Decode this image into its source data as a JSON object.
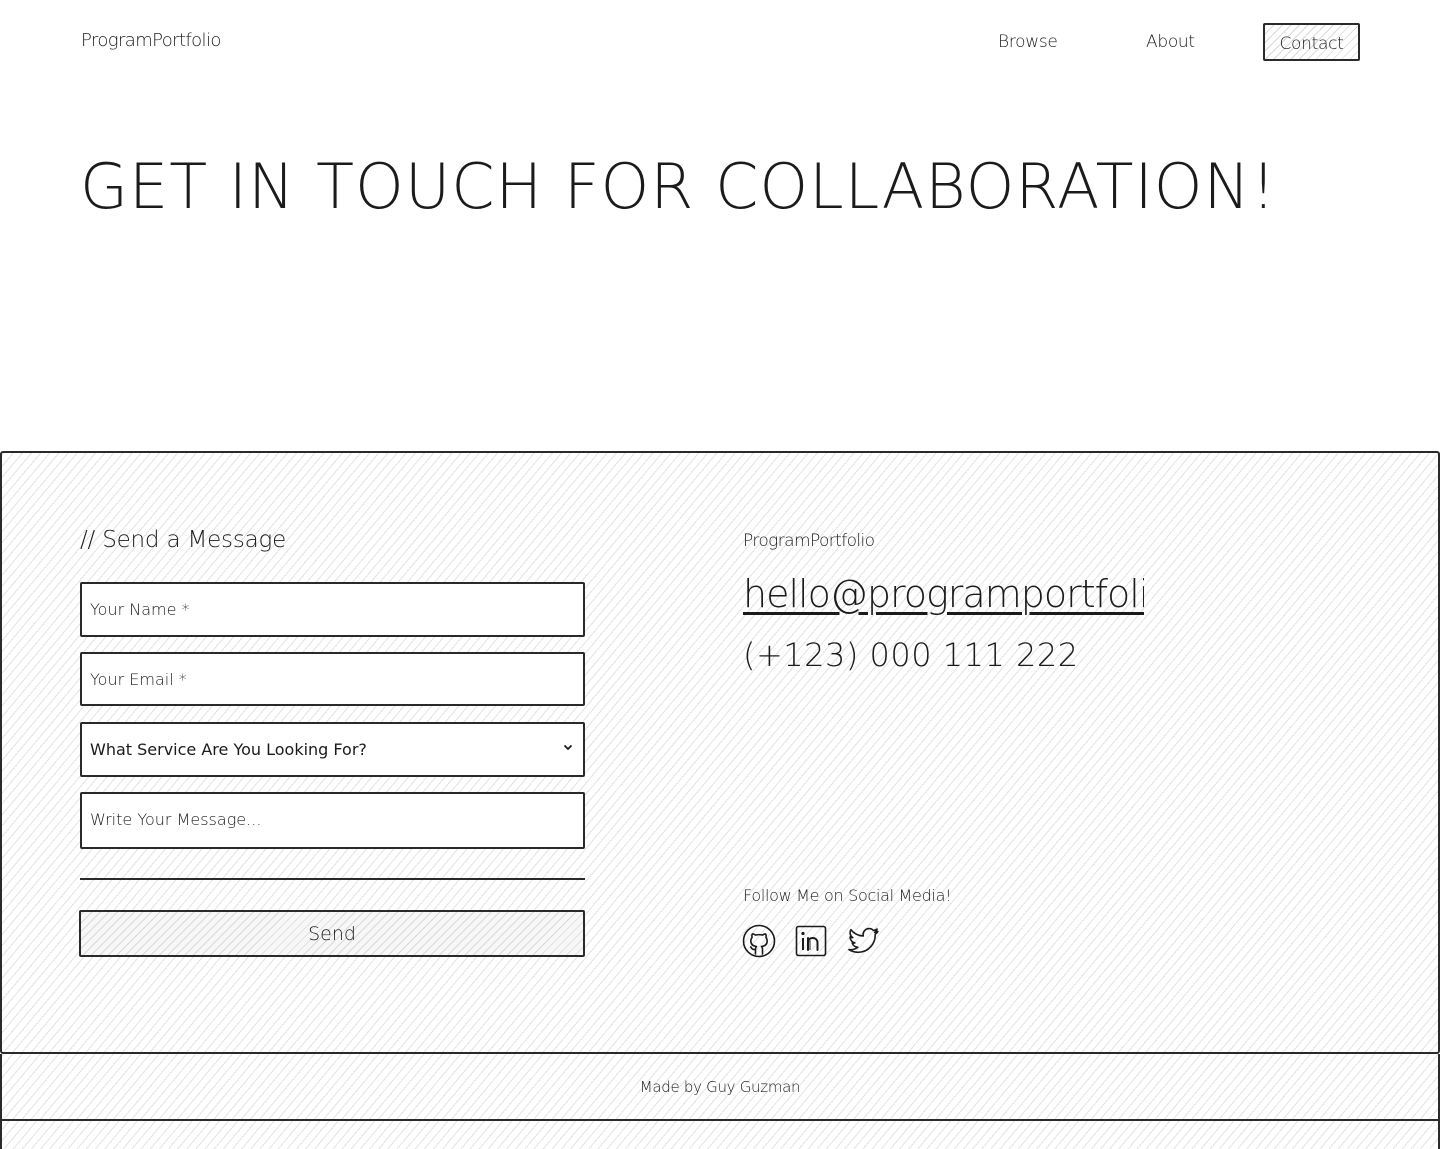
{
  "header": {
    "brand": "ProgramPortfolio",
    "nav": {
      "browse": "Browse",
      "about": "About",
      "contact": "Contact"
    }
  },
  "hero": {
    "title": "Get in touch for collaboration!"
  },
  "form": {
    "heading": "// Send a Message",
    "name_placeholder": "Your Name *",
    "email_placeholder": "Your Email *",
    "service_placeholder": "What Service Are You Looking For?",
    "message_placeholder": "Write Your Message...",
    "send_label": "Send"
  },
  "contact": {
    "brand": "ProgramPortfolio",
    "email": "hello@programportfolio.com",
    "phone": "(+123) 000 111 222",
    "social_label": "Follow Me on Social Media!",
    "social": [
      {
        "icon": "github-icon"
      },
      {
        "icon": "linkedin-icon"
      },
      {
        "icon": "twitter-icon"
      }
    ]
  },
  "footer": {
    "text": "Made by Guy Guzman"
  },
  "colors": {
    "ink": "#1b1b1b",
    "border": "#2a2a2a",
    "hatch": "#e3e3e3",
    "background": "#ffffff"
  }
}
